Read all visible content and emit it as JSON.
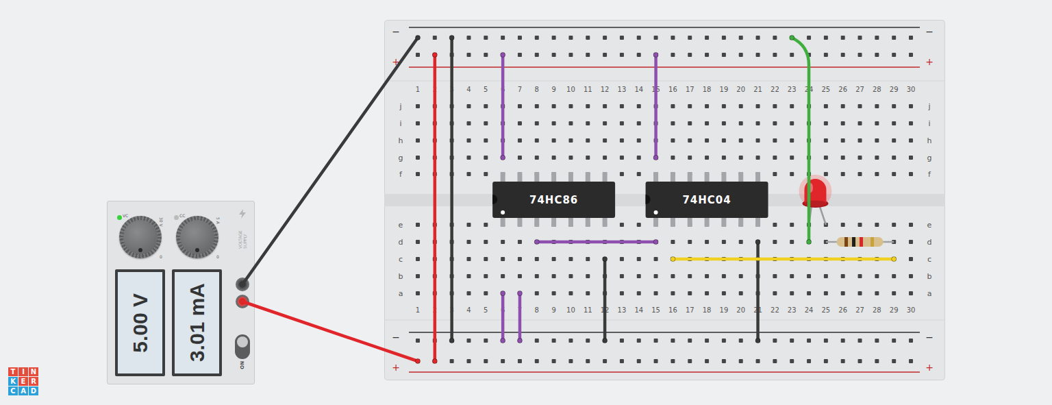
{
  "supply": {
    "title": "VOLTAGE SUPPLY",
    "switch": {
      "label": "ON",
      "on": true
    },
    "channels": [
      {
        "indicator": "VC",
        "active": true,
        "max": "30 V",
        "min": "0",
        "reading": "5.00 V"
      },
      {
        "indicator": "CC",
        "active": false,
        "max": "5 A",
        "min": "0",
        "reading": "3.01 mA"
      }
    ],
    "terminals": [
      {
        "polarity": "negative",
        "color": "#3a3a3a"
      },
      {
        "polarity": "positive",
        "color": "#d42a2a"
      }
    ]
  },
  "breadboard": {
    "rail_signs": {
      "negative": "−",
      "positive": "+"
    },
    "columns": [
      "1",
      "2",
      "3",
      "4",
      "5",
      "6",
      "7",
      "8",
      "9",
      "10",
      "11",
      "12",
      "13",
      "14",
      "15",
      "16",
      "17",
      "18",
      "19",
      "20",
      "21",
      "22",
      "23",
      "24",
      "25",
      "26",
      "27",
      "28",
      "29",
      "30"
    ],
    "rows_top": [
      "j",
      "i",
      "h",
      "g",
      "f"
    ],
    "rows_bottom": [
      "e",
      "d",
      "c",
      "b",
      "a"
    ]
  },
  "chips": [
    {
      "label": "74HC86",
      "pin1": "e6"
    },
    {
      "label": "74HC04",
      "pin1": "e15"
    }
  ],
  "led": {
    "on": true,
    "cathode": "e24",
    "anode": "e25"
  },
  "resistor": {
    "from": "d25",
    "to": "d29",
    "bands": [
      "#7a4515",
      "#1e1e1e",
      "#d8262a",
      "#c9a23c"
    ]
  },
  "wires": [
    {
      "color": "#e0262a",
      "from": "top+2",
      "to": "bot+2"
    },
    {
      "color": "#3a3a3a",
      "from": "top-3",
      "to": "bot-3"
    },
    {
      "color": "#8e4fae",
      "from": "top+6",
      "to": "g6"
    },
    {
      "color": "#8e4fae",
      "from": "top+15",
      "to": "g15"
    },
    {
      "color": "#8e4fae",
      "from": "d8",
      "to": "d15"
    },
    {
      "color": "#8e4fae",
      "from": "a6",
      "to": "bot-6"
    },
    {
      "color": "#8e4fae",
      "from": "a7",
      "to": "bot-7"
    },
    {
      "color": "#3a3a3a",
      "from": "c12",
      "to": "bot-12"
    },
    {
      "color": "#3a3a3a",
      "from": "d21",
      "to": "bot-21"
    },
    {
      "color": "#f0d020",
      "from": "c16",
      "to": "c29"
    },
    {
      "color": "#3fae3f",
      "from": "top-23",
      "to": "d24"
    }
  ],
  "supply_wires": [
    {
      "color": "#3a3a3a",
      "from": "negative",
      "to": "top-1"
    },
    {
      "color": "#e0262a",
      "from": "positive",
      "to": "bot+1"
    }
  ],
  "logo": [
    {
      "char": "T",
      "color": "#e64c3c"
    },
    {
      "char": "I",
      "color": "#e64c3c"
    },
    {
      "char": "N",
      "color": "#e64c3c"
    },
    {
      "char": "K",
      "color": "#2ca0d9"
    },
    {
      "char": "E",
      "color": "#e64c3c"
    },
    {
      "char": "R",
      "color": "#e64c3c"
    },
    {
      "char": "C",
      "color": "#2ca0d9"
    },
    {
      "char": "A",
      "color": "#2ca0d9"
    },
    {
      "char": "D",
      "color": "#2ca0d9"
    }
  ]
}
